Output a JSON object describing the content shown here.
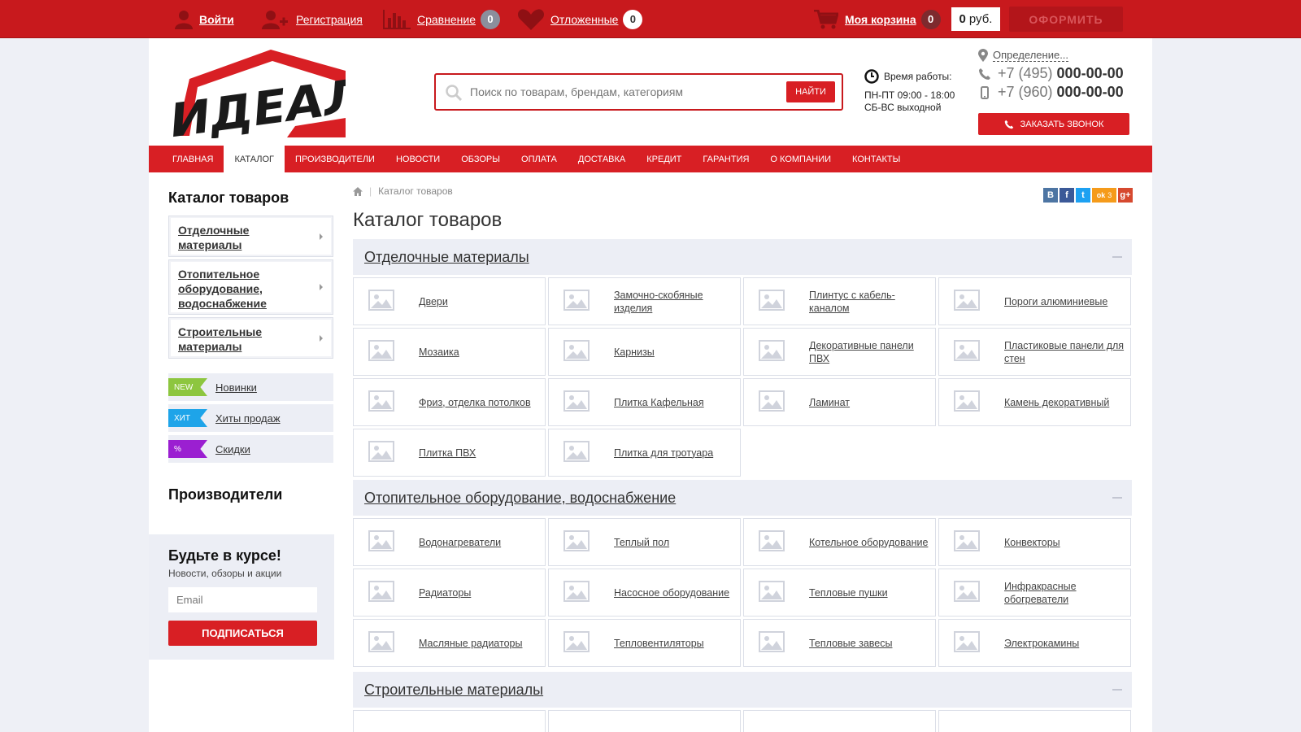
{
  "topbar": {
    "login": "Войти",
    "register": "Регистрация",
    "compare": "Сравнение",
    "compare_count": "0",
    "wishlist": "Отложенные",
    "wishlist_count": "0",
    "cart": "Моя корзина",
    "cart_count": "0",
    "price_value": "0",
    "price_currency": "руб.",
    "checkout": "ОФОРМИТЬ"
  },
  "header": {
    "logo_text": "ИДЕАЛ",
    "search_placeholder": "Поиск по товарам, брендам, категориям",
    "search_button": "НАЙТИ",
    "hours_title": "Время работы:",
    "hours_weekdays": "ПН-ПТ 09:00 - 18:00",
    "hours_weekend": "СБ-ВС выходной",
    "location": "Определение...",
    "phone1_code": "+7 (495)",
    "phone1_number": "000-00-00",
    "phone2_code": "+7 (960)",
    "phone2_number": "000-00-00",
    "callback": "ЗАКАЗАТЬ ЗВОНОК"
  },
  "nav": [
    "ГЛАВНАЯ",
    "КАТАЛОГ",
    "ПРОИЗВОДИТЕЛИ",
    "НОВОСТИ",
    "ОБЗОРЫ",
    "ОПЛАТА",
    "ДОСТАВКА",
    "КРЕДИТ",
    "ГАРАНТИЯ",
    "О КОМПАНИИ",
    "КОНТАКТЫ"
  ],
  "nav_active": 1,
  "sidebar": {
    "catalog_title": "Каталог товаров",
    "categories": [
      "Отделочные материалы",
      "Отопительное оборудование, водоснабжение",
      "Строительные материалы"
    ],
    "tags": [
      {
        "badge": "NEW",
        "label": "Новинки",
        "color": "#8dc63f"
      },
      {
        "badge": "ХИТ",
        "label": "Хиты продаж",
        "color": "#1ea4e9"
      },
      {
        "badge": "%",
        "label": "Скидки",
        "color": "#9b1fd1"
      }
    ],
    "makers_title": "Производители",
    "subscribe_title": "Будьте в курсе!",
    "subscribe_text": "Новости, обзоры и акции",
    "email_placeholder": "Email",
    "subscribe_button": "ПОДПИСАТЬСЯ"
  },
  "main": {
    "breadcrumb": "Каталог товаров",
    "title": "Каталог товаров",
    "share": [
      "В",
      "f",
      "t",
      "ok",
      "g+"
    ],
    "share_count": "3",
    "sections": [
      {
        "title": "Отделочные материалы",
        "items": [
          "Двери",
          "Замочно-скобяные изделия",
          "Плинтус с кабель-каналом",
          "Пороги алюминиевые",
          "Мозаика",
          "Карнизы",
          "Декоративные панели ПВХ",
          "Пластиковые панели для стен",
          "Фриз, отделка потолков",
          "Плитка Кафельная",
          "Ламинат",
          "Камень декоративный",
          "Плитка ПВХ",
          "Плитка для тротуара"
        ]
      },
      {
        "title": "Отопительное оборудование, водоснабжение",
        "items": [
          "Водонагреватели",
          "Теплый пол",
          "Котельное оборудование",
          "Конвекторы",
          "Радиаторы",
          "Насосное оборудование",
          "Тепловые пушки",
          "Инфракрасные обогреватели",
          "Масляные радиаторы",
          "Тепловентиляторы",
          "Тепловые завесы",
          "Электрокамины"
        ]
      },
      {
        "title": "Строительные материалы",
        "items": []
      }
    ]
  },
  "colors": {
    "brand_red": "#d81f24",
    "topbar_red": "#c8191d",
    "panel_gray": "#eceef5"
  }
}
